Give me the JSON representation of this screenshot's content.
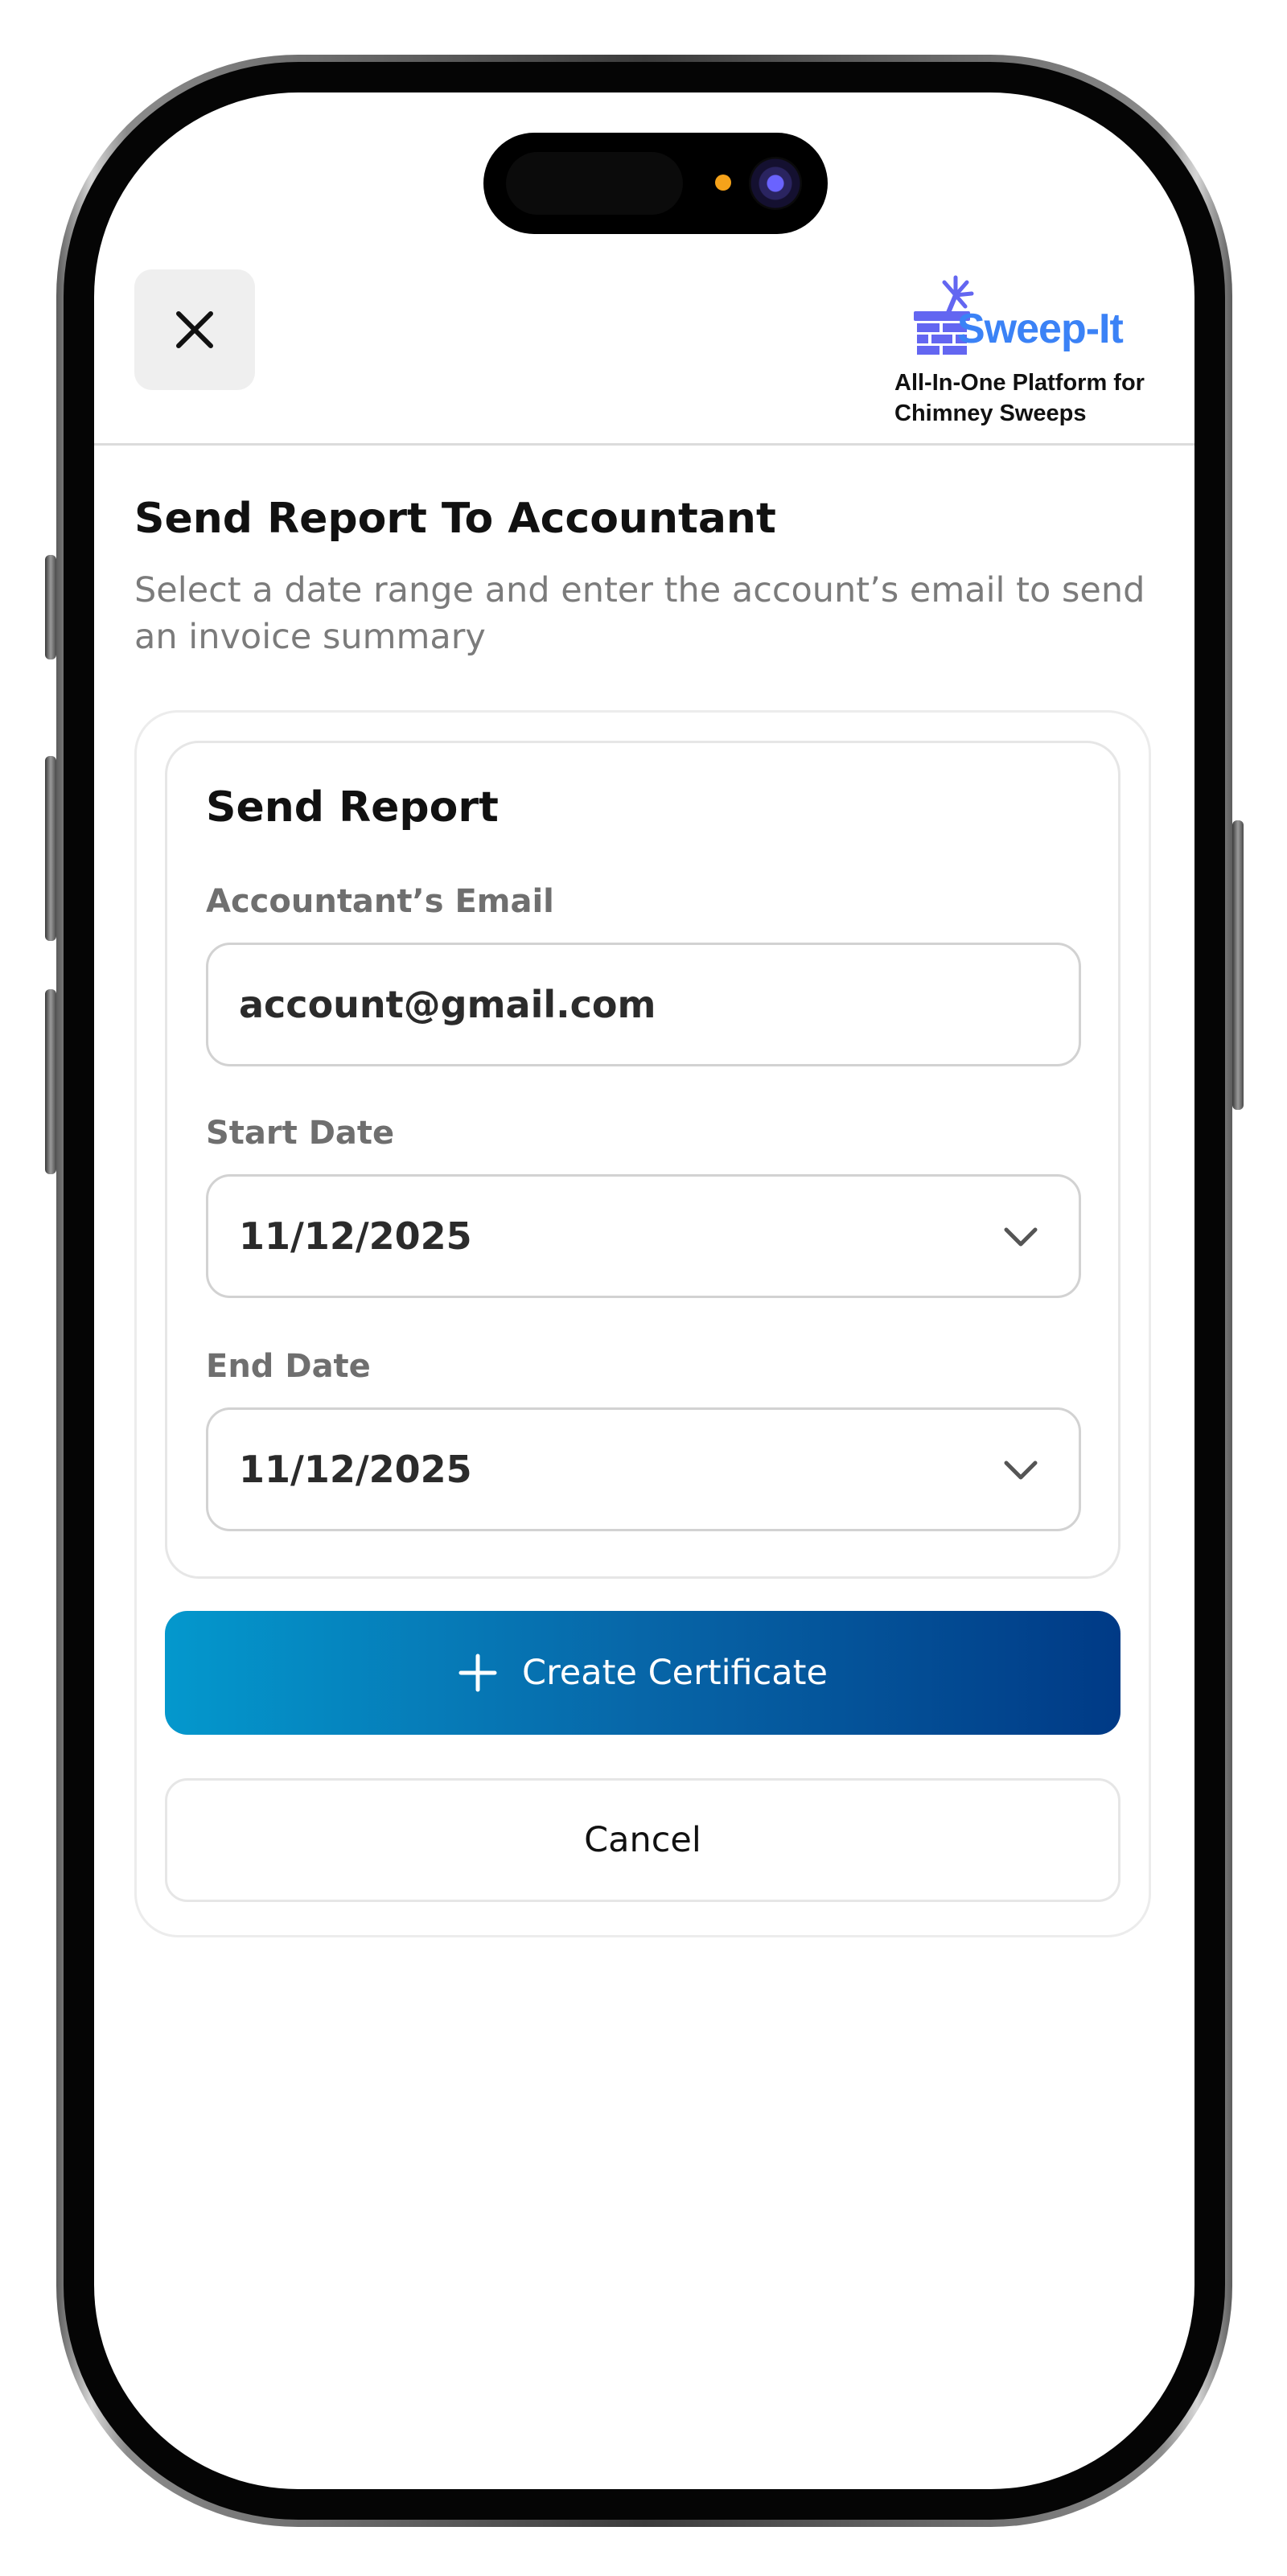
{
  "header": {
    "close_icon": "close-icon",
    "brand": {
      "logo_icon": "chimney-brush-logo-icon",
      "name": "Sweep-It",
      "tagline_line1": "All-In-One Platform for",
      "tagline_line2": "Chimney Sweeps",
      "brand_color": "#3b82f6",
      "logo_color": "#6366f1"
    }
  },
  "page": {
    "title": "Send Report To Accountant",
    "subtitle": "Select a date range and enter the account’s email to send an invoice summary"
  },
  "form": {
    "title": "Send Report",
    "email": {
      "label": "Accountant’s Email",
      "value": "account@gmail.com"
    },
    "start_date": {
      "label": "Start Date",
      "value": "11/12/2025",
      "icon": "chevron-down-icon"
    },
    "end_date": {
      "label": "End Date",
      "value": "11/12/2025",
      "icon": "chevron-down-icon"
    }
  },
  "actions": {
    "primary": {
      "label": "Create Certificate",
      "icon": "plus-icon",
      "gradient_start": "#0498cd",
      "gradient_end": "#003a86"
    },
    "cancel": {
      "label": "Cancel"
    }
  }
}
